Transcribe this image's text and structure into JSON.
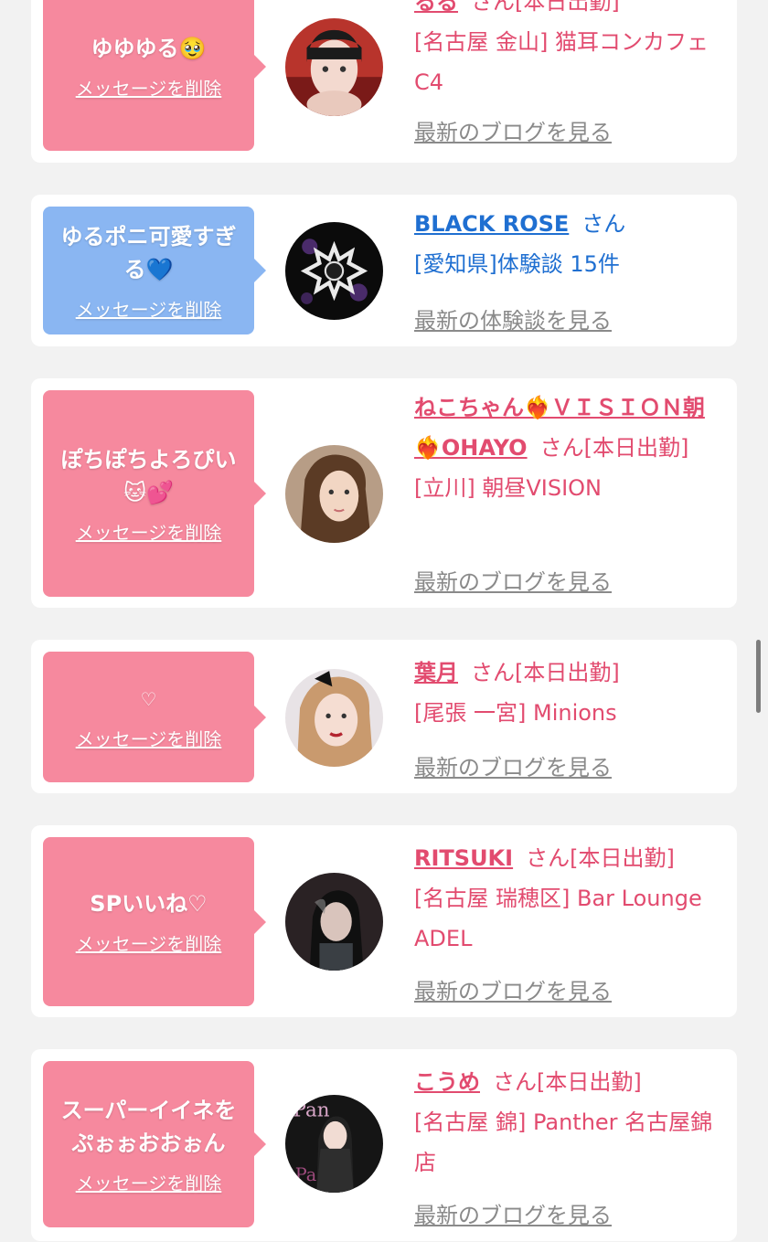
{
  "cards": [
    {
      "message": "ゆゆゆる🥹",
      "delete_label": "メッセージを削除",
      "name": "るる",
      "suffix": "さん[本日出勤]",
      "shop": "[名古屋 金山] 猫耳コンカフェ C4",
      "latest_link": "最新のブログを見る"
    },
    {
      "message": "ゆるポニ可愛すぎる💙",
      "delete_label": "メッセージを削除",
      "name": "BLACK ROSE",
      "suffix": "さん",
      "shop": "[愛知県]体験談 15件",
      "latest_link": "最新の体験談を見る"
    },
    {
      "message": "ぽちぽちよろぴい🐱💕",
      "delete_label": "メッセージを削除",
      "name": "ねこちゃん❤️‍🔥ＶＩＳＩＯＮ朝❤️‍🔥OHAYO",
      "suffix": "さん[本日出勤]",
      "shop": "[立川] 朝昼VISION",
      "latest_link": "最新のブログを見る"
    },
    {
      "message": "♡",
      "delete_label": "メッセージを削除",
      "name": "葉月",
      "suffix": "さん[本日出勤]",
      "shop": "[尾張 一宮] Minions",
      "latest_link": "最新のブログを見る"
    },
    {
      "message": "SPいいね♡",
      "delete_label": "メッセージを削除",
      "name": "RITSUKI",
      "suffix": "さん[本日出勤]",
      "shop": "[名古屋 瑞穂区] Bar Lounge ADEL",
      "latest_link": "最新のブログを見る"
    },
    {
      "message": "スーパーイイネをぷぉぉおおぉん",
      "delete_label": "メッセージを削除",
      "name": "こうめ",
      "suffix": "さん[本日出勤]",
      "shop": "[名古屋 錦] Panther 名古屋錦店",
      "latest_link": "最新のブログを見る"
    }
  ],
  "colors": {
    "pink_bubble": "#f6899e",
    "blue_bubble": "#8ab6f2",
    "girl_name": "#e24b6f",
    "shop_name": "#1f6fd1",
    "muted_link": "#8a8a8a"
  },
  "avatars": [
    "girl-portrait",
    "black-rose-logo",
    "girl-portrait",
    "girl-portrait",
    "girl-portrait",
    "panther-portrait"
  ]
}
